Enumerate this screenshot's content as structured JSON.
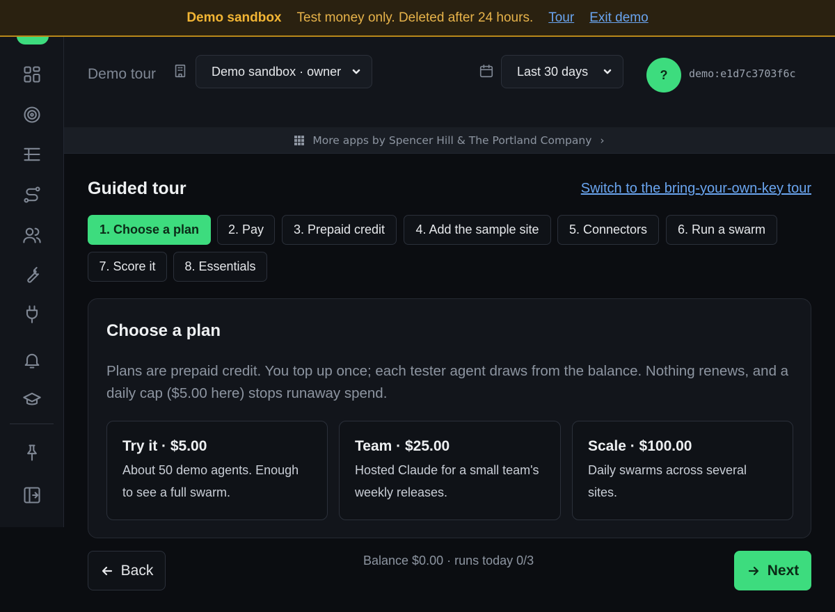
{
  "banner": {
    "title": "Demo sandbox",
    "message": "Test money only. Deleted after 24 hours.",
    "tour_link": "Tour",
    "exit_link": "Exit demo",
    "accent_color": "#f2b534"
  },
  "sidebar": {
    "icons": [
      "dashboard-icon",
      "target-icon",
      "list-tree-icon",
      "route-icon",
      "users-icon",
      "wrench-icon",
      "plug-icon",
      "bell-icon",
      "graduation-cap-icon",
      "pin-icon",
      "sign-in-icon"
    ]
  },
  "header": {
    "label": "Demo tour",
    "org_select": "Demo sandbox · owner",
    "range_select": "Last 30 days",
    "avatar_initial": "?",
    "user_id": "demo:e1d7c3703f6c"
  },
  "apps_bar": {
    "text": "More apps by Spencer Hill & The Portland Company",
    "arrow": "›"
  },
  "tour": {
    "title": "Guided tour",
    "switch_link": "Switch to the bring-your-own-key tour",
    "steps": [
      "1. Choose a plan",
      "2. Pay",
      "3. Prepaid credit",
      "4. Add the sample site",
      "5. Connectors",
      "6. Run a swarm",
      "7. Score it",
      "8. Essentials"
    ],
    "active_step": 0
  },
  "card": {
    "title": "Choose a plan",
    "description": "Plans are prepaid credit. You top up once; each tester agent draws from the balance. Nothing renews, and a daily cap ($5.00 here) stops runaway spend.",
    "plans": [
      {
        "name": "Try it · $5.00",
        "desc": "About 50 demo agents. Enough to see a full swarm."
      },
      {
        "name": "Team · $25.00",
        "desc": "Hosted Claude for a small team's weekly releases."
      },
      {
        "name": "Scale · $100.00",
        "desc": "Daily swarms across several sites."
      }
    ]
  },
  "footer": {
    "back_label": "Back",
    "balance": "Balance $0.00 · runs today 0/3",
    "next_label": "Next",
    "accent_color": "#3ddc7e"
  }
}
